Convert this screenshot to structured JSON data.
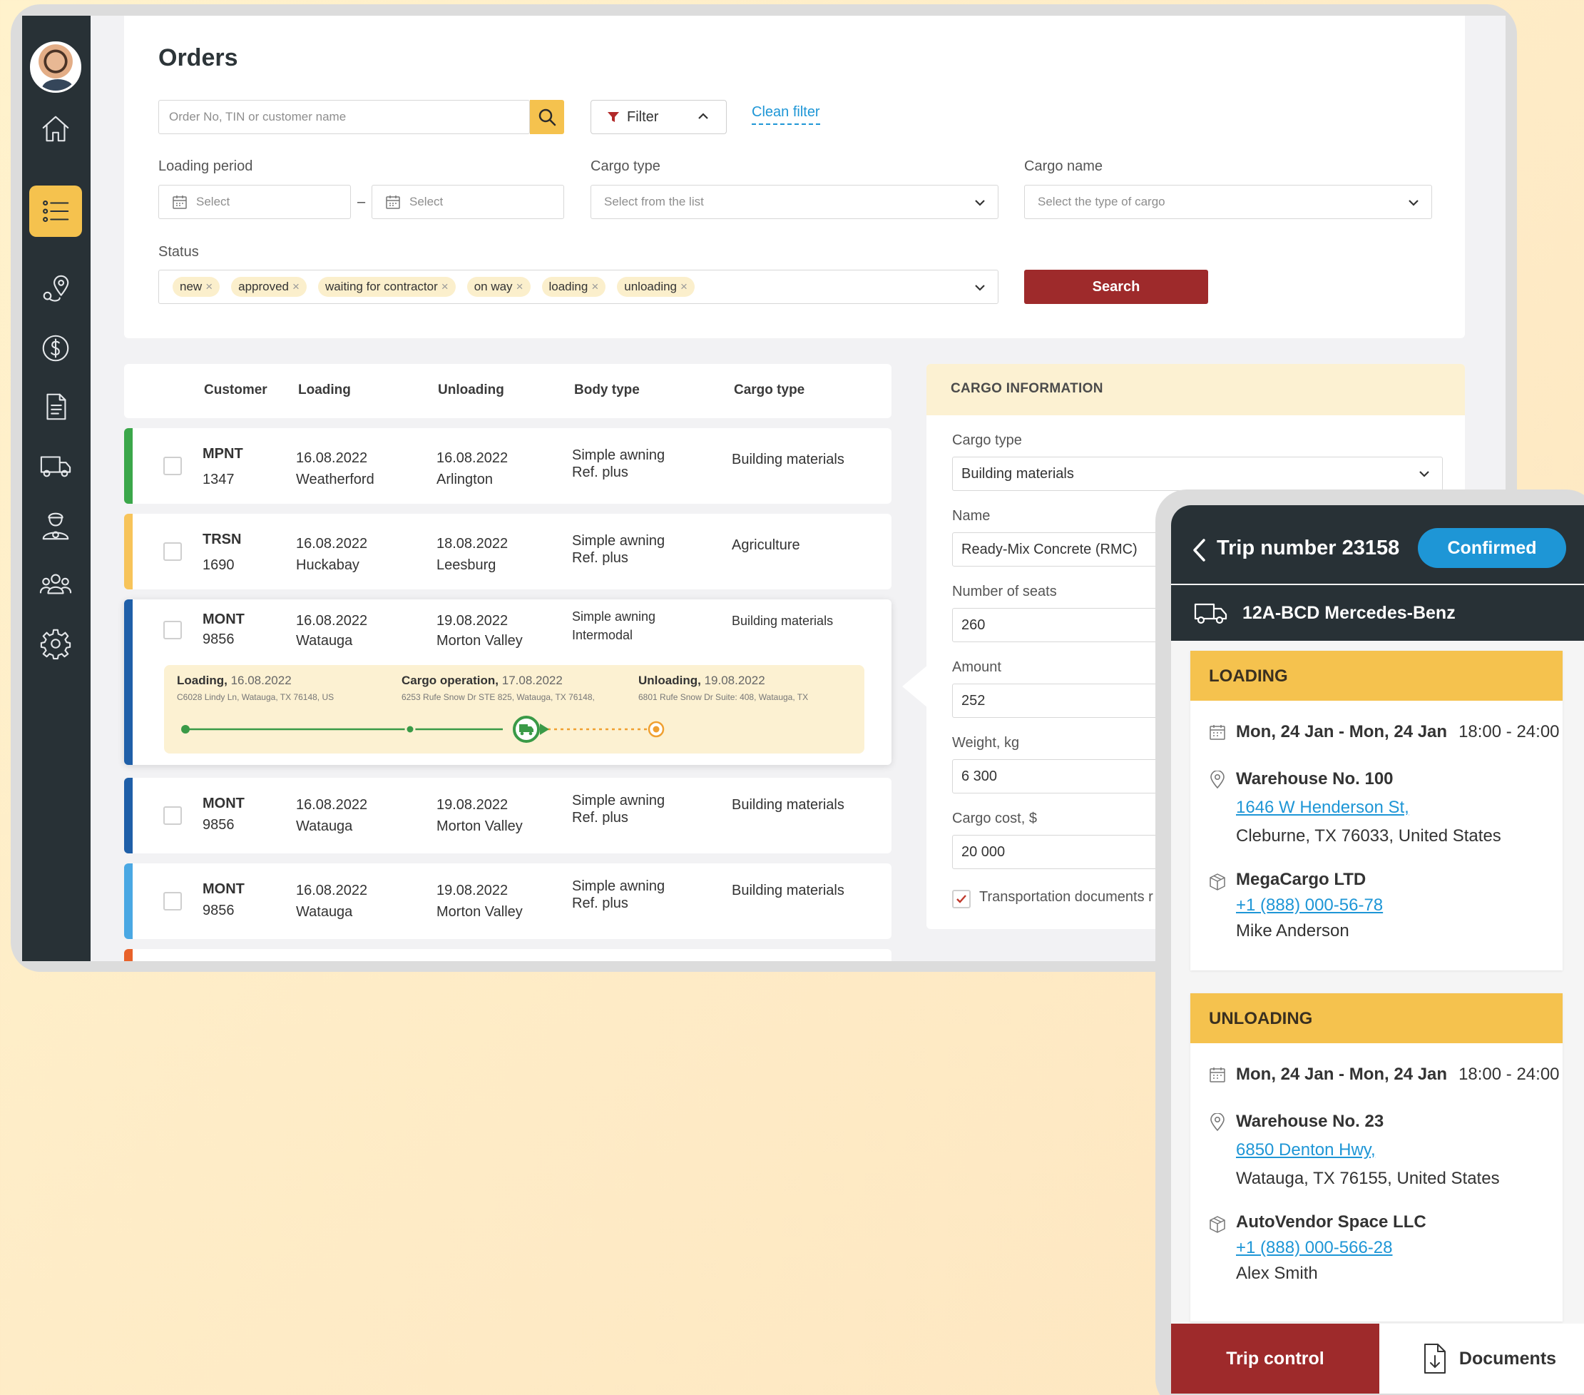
{
  "page": {
    "title": "Orders"
  },
  "search": {
    "placeholder": "Order No, TIN or customer name"
  },
  "filter": {
    "label": "Filter",
    "clean_label": "Clean filter"
  },
  "loading_period": {
    "label": "Loading period",
    "from_placeholder": "Select",
    "to_placeholder": "Select",
    "separator": "–"
  },
  "cargo_type": {
    "label": "Cargo type",
    "placeholder": "Select from the list"
  },
  "cargo_name": {
    "label": "Cargo name",
    "placeholder": "Select the type of cargo"
  },
  "status": {
    "label": "Status",
    "tags": [
      "new",
      "approved",
      "waiting for contractor",
      "on way",
      "loading",
      "unloading"
    ],
    "remove_glyph": "×"
  },
  "search_button": "Search",
  "table": {
    "columns": [
      "Customer",
      "Loading",
      "Unloading",
      "Body type",
      "Cargo type"
    ],
    "rows": [
      {
        "color": "#3ba74a",
        "code": "MPNT",
        "num": "1347",
        "load_date": "16.08.2022",
        "load_city": "Weatherford",
        "unload_date": "16.08.2022",
        "unload_city": "Arlington",
        "body1": "Simple awning",
        "body2": "Ref. plus",
        "cargo": "Building materials"
      },
      {
        "color": "#f7c45a",
        "code": "TRSN",
        "num": "1690",
        "load_date": "16.08.2022",
        "load_city": "Huckabay",
        "unload_date": "18.08.2022",
        "unload_city": "Leesburg",
        "body1": "Simple awning",
        "body2": "Ref. plus",
        "cargo": "Agriculture"
      },
      {
        "color": "#1f5fa8",
        "code": "MONT",
        "num": "9856",
        "load_date": "16.08.2022",
        "load_city": "Watauga",
        "unload_date": "19.08.2022",
        "unload_city": "Morton Valley",
        "body1": "Simple awning",
        "body2": "Intermodal",
        "cargo": "Building materials"
      },
      {
        "color": "#1f5fa8",
        "code": "MONT",
        "num": "9856",
        "load_date": "16.08.2022",
        "load_city": "Watauga",
        "unload_date": "19.08.2022",
        "unload_city": "Morton Valley",
        "body1": "Simple awning",
        "body2": "Ref. plus",
        "cargo": "Building materials"
      },
      {
        "color": "#4aa8e3",
        "code": "MONT",
        "num": "9856",
        "load_date": "16.08.2022",
        "load_city": "Watauga",
        "unload_date": "19.08.2022",
        "unload_city": "Morton Valley",
        "body1": "Simple awning",
        "body2": "Ref. plus",
        "cargo": "Building materials"
      }
    ],
    "next_row_color": "#e8622a"
  },
  "route": {
    "loading": {
      "title": "Loading,",
      "date": "16.08.2022",
      "address": "C6028 Lindy Ln, Watauga, TX 76148, US"
    },
    "operation": {
      "title": "Cargo operation,",
      "date": "17.08.2022",
      "address": "6253 Rufe Snow Dr STE 825, Watauga, TX 76148,"
    },
    "unloading": {
      "title": "Unloading,",
      "date": "19.08.2022",
      "address": "6801 Rufe Snow Dr Suite: 408, Watauga, TX"
    }
  },
  "cargo_info": {
    "header": "CARGO INFORMATION",
    "cargo_type_label": "Cargo type",
    "cargo_type_value": "Building materials",
    "name_label": "Name",
    "name_value": "Ready-Mix Concrete (RMC)",
    "seats_label": "Number of seats",
    "seats_value": "260",
    "amount_label": "Amount",
    "amount_value": "252",
    "weight_label": "Weight, kg",
    "weight_value": "6 300",
    "cost_label": "Cargo cost, $",
    "cost_value": "20 000",
    "docs_label": "Transportation documents r"
  },
  "mobile": {
    "trip_title": "Trip number 23158",
    "status": "Confirmed",
    "vehicle": "12A-BCD  Mercedes-Benz",
    "loading": {
      "header": "LOADING",
      "dates": "Mon, 24 Jan - Mon, 24 Jan",
      "time": "18:00 - 24:00",
      "warehouse": "Warehouse No. 100",
      "street": "1646 W Henderson St,",
      "city": "Cleburne, TX 76033, United States",
      "company": "MegaCargo LTD",
      "phone": "+1 (888) 000-56-78",
      "contact": "Mike Anderson"
    },
    "unloading": {
      "header": "UNLOADING",
      "dates": "Mon, 24 Jan - Mon, 24 Jan",
      "time": "18:00 - 24:00",
      "warehouse": "Warehouse No. 23",
      "street": "6850 Denton Hwy,",
      "city": "Watauga, TX 76155, United States",
      "company": "AutoVendor Space LLC",
      "phone": "+1 (888) 000-566-28",
      "contact": "Alex Smith"
    },
    "trip_control": "Trip control",
    "documents": "Documents"
  },
  "colors": {
    "accent_yellow": "#f5c24e",
    "primary_red": "#9e2a2b",
    "sidebar_dark": "#283136",
    "link_blue": "#1e96d6",
    "route_green": "#3a9a47",
    "route_orange": "#f0a030"
  },
  "icons": [
    "home-icon",
    "list-icon",
    "route-icon",
    "dollar-icon",
    "document-icon",
    "truck-icon",
    "driver-icon",
    "users-icon",
    "settings-icon",
    "search-icon",
    "filter-icon",
    "calendar-icon",
    "chevron-down-icon",
    "back-icon",
    "location-icon",
    "package-icon",
    "download-icon"
  ]
}
